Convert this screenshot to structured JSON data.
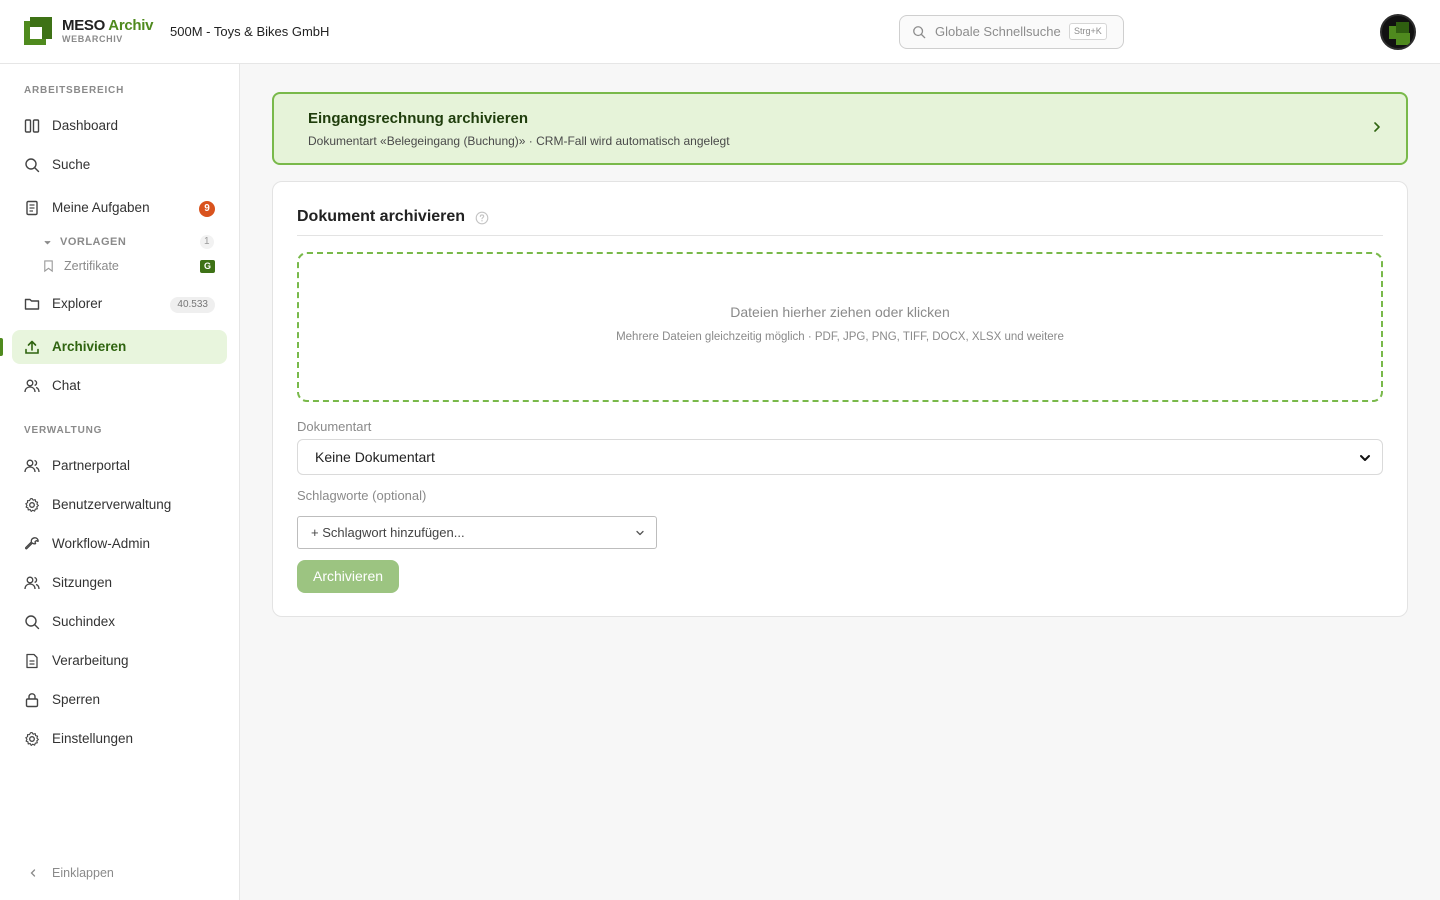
{
  "app": {
    "brand_main": "MESO",
    "brand_accent": "Archiv",
    "brand_sub": "WEBARCHIV",
    "tenant": "500M - Toys & Bikes GmbH"
  },
  "search": {
    "placeholder": "Globale Schnellsuche",
    "shortcut": "Strg+K"
  },
  "sidebar": {
    "section_work": "ARBEITSBEREICH",
    "section_admin": "VERWALTUNG",
    "items": {
      "dashboard": "Dashboard",
      "suche": "Suche",
      "aufgaben": "Meine Aufgaben",
      "aufgaben_badge": "9",
      "vorlagen": "VORLAGEN",
      "vorlagen_count": "1",
      "zertifikate": "Zertifikate",
      "zertifikate_badge": "G",
      "explorer": "Explorer",
      "explorer_count": "40.533",
      "archivieren": "Archivieren",
      "chat": "Chat",
      "partnerportal": "Partnerportal",
      "benutzer": "Benutzerverwaltung",
      "workflow": "Workflow-Admin",
      "sitzungen": "Sitzungen",
      "suchindex": "Suchindex",
      "verarbeitung": "Verarbeitung",
      "sperren": "Sperren",
      "einstellungen": "Einstellungen"
    },
    "collapse": "Einklappen"
  },
  "banner": {
    "title": "Eingangsrechnung archivieren",
    "subtitle": "Dokumentart «Belegeingang (Buchung)» · CRM-Fall wird automatisch angelegt"
  },
  "card": {
    "title": "Dokument archivieren",
    "dropzone_main": "Dateien hierher ziehen oder klicken",
    "dropzone_sub": "Mehrere Dateien gleichzeitig möglich · PDF, JPG, PNG, TIFF, DOCX, XLSX und weitere",
    "doctype_label": "Dokumentart",
    "doctype_value": "Keine Dokumentart",
    "tags_label": "Schlagworte (optional)",
    "tags_placeholder": "+ Schlagwort hinzufügen...",
    "submit": "Archivieren"
  },
  "colors": {
    "accent": "#4f8a1e",
    "active_bg": "#e8f5dd",
    "banner_bg": "#e6f3d9",
    "badge_red": "#d9531e",
    "button_disabled": "#9cc481"
  },
  "icons": [
    "search-icon",
    "dashboard-icon",
    "tasks-icon",
    "chevron-down-icon",
    "bookmark-icon",
    "folder-icon",
    "upload-icon",
    "users-icon",
    "gear-icon",
    "wrench-icon",
    "document-icon",
    "lock-icon",
    "chevron-left-icon",
    "chevron-right-icon",
    "help-icon"
  ]
}
